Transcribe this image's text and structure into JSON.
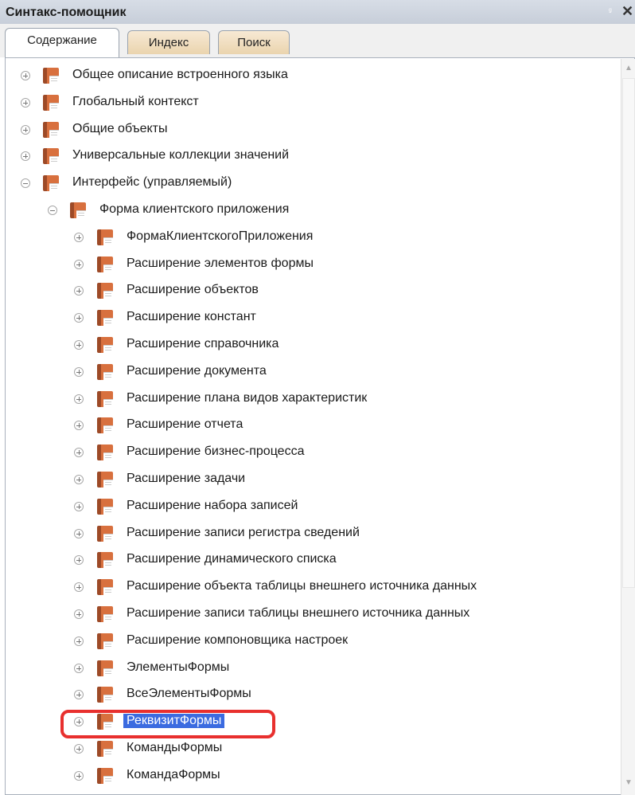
{
  "window": {
    "title": "Синтакс-помощник",
    "pin_glyph": "ᵍ",
    "close_glyph": "✕"
  },
  "tabs": [
    {
      "label": "Содержание",
      "active": true
    },
    {
      "label": "Индекс",
      "active": false
    },
    {
      "label": "Поиск",
      "active": false
    }
  ],
  "tree": [
    {
      "label": "Общее описание встроенного языка",
      "level": 0,
      "expanded": false,
      "selected": false
    },
    {
      "label": "Глобальный контекст",
      "level": 0,
      "expanded": false,
      "selected": false
    },
    {
      "label": "Общие объекты",
      "level": 0,
      "expanded": false,
      "selected": false
    },
    {
      "label": "Универсальные коллекции значений",
      "level": 0,
      "expanded": false,
      "selected": false
    },
    {
      "label": "Интерфейс (управляемый)",
      "level": 0,
      "expanded": true,
      "selected": false
    },
    {
      "label": "Форма клиентского приложения",
      "level": 1,
      "expanded": true,
      "selected": false
    },
    {
      "label": "ФормаКлиентскогоПриложения",
      "level": 2,
      "expanded": false,
      "selected": false
    },
    {
      "label": "Расширение элементов формы",
      "level": 2,
      "expanded": false,
      "selected": false
    },
    {
      "label": "Расширение объектов",
      "level": 2,
      "expanded": false,
      "selected": false
    },
    {
      "label": "Расширение констант",
      "level": 2,
      "expanded": false,
      "selected": false
    },
    {
      "label": "Расширение справочника",
      "level": 2,
      "expanded": false,
      "selected": false
    },
    {
      "label": "Расширение документа",
      "level": 2,
      "expanded": false,
      "selected": false
    },
    {
      "label": "Расширение плана видов характеристик",
      "level": 2,
      "expanded": false,
      "selected": false
    },
    {
      "label": "Расширение отчета",
      "level": 2,
      "expanded": false,
      "selected": false
    },
    {
      "label": "Расширение бизнес-процесса",
      "level": 2,
      "expanded": false,
      "selected": false
    },
    {
      "label": "Расширение задачи",
      "level": 2,
      "expanded": false,
      "selected": false
    },
    {
      "label": "Расширение набора записей",
      "level": 2,
      "expanded": false,
      "selected": false
    },
    {
      "label": "Расширение записи регистра сведений",
      "level": 2,
      "expanded": false,
      "selected": false
    },
    {
      "label": "Расширение динамического списка",
      "level": 2,
      "expanded": false,
      "selected": false
    },
    {
      "label": "Расширение объекта таблицы внешнего источника данных",
      "level": 2,
      "expanded": false,
      "selected": false
    },
    {
      "label": "Расширение записи таблицы внешнего источника данных",
      "level": 2,
      "expanded": false,
      "selected": false
    },
    {
      "label": "Расширение компоновщика настроек",
      "level": 2,
      "expanded": false,
      "selected": false
    },
    {
      "label": "ЭлементыФормы",
      "level": 2,
      "expanded": false,
      "selected": false
    },
    {
      "label": "ВсеЭлементыФормы",
      "level": 2,
      "expanded": false,
      "selected": false
    },
    {
      "label": "РеквизитФормы",
      "level": 2,
      "expanded": false,
      "selected": true
    },
    {
      "label": "КомандыФормы",
      "level": 2,
      "expanded": false,
      "selected": false
    },
    {
      "label": "КомандаФормы",
      "level": 2,
      "expanded": false,
      "selected": false
    }
  ],
  "colors": {
    "selection": "#3b6be0",
    "highlight_ring": "#e8302e",
    "book_dark": "#9d4a27",
    "book_light": "#d8703e"
  }
}
